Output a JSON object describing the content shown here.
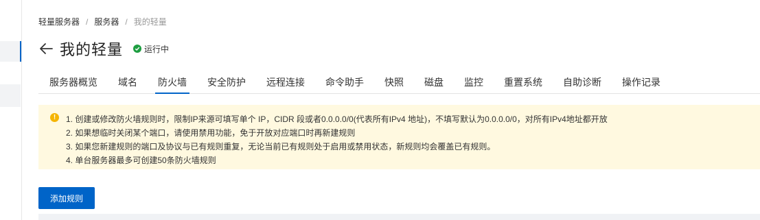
{
  "breadcrumb": {
    "items": [
      "轻量服务器",
      "服务器",
      "我的轻量"
    ],
    "separator": "/"
  },
  "header": {
    "title": "我的轻量",
    "status": "运行中",
    "status_color": "#1e9e41"
  },
  "tabs": [
    {
      "label": "服务器概览",
      "active": false
    },
    {
      "label": "域名",
      "active": false
    },
    {
      "label": "防火墙",
      "active": true
    },
    {
      "label": "安全防护",
      "active": false
    },
    {
      "label": "远程连接",
      "active": false
    },
    {
      "label": "命令助手",
      "active": false
    },
    {
      "label": "快照",
      "active": false
    },
    {
      "label": "磁盘",
      "active": false
    },
    {
      "label": "监控",
      "active": false
    },
    {
      "label": "重置系统",
      "active": false
    },
    {
      "label": "自助诊断",
      "active": false
    },
    {
      "label": "操作记录",
      "active": false
    }
  ],
  "notice": {
    "icon": "warning-icon",
    "lines": [
      "1. 创建或修改防火墙规则时，限制IP来源可填写单个 IP，CIDR 段或者0.0.0.0/0(代表所有IPv4 地址)，不填写默认为0.0.0.0/0，对所有IPv4地址都开放",
      "2. 如果想临时关闭某个端口，请使用禁用功能，免于开放对应端口时再新建规则",
      "3. 如果您新建规则的端口及协议与已有规则重复，无论当前已有规则处于启用或禁用状态，新规则均会覆盖已有规则。",
      "4. 单台服务器最多可创建50条防火墙规则"
    ]
  },
  "actions": {
    "add_rule_label": "添加规则"
  },
  "colors": {
    "accent": "#0064c8",
    "notice_bg": "#fff9e0",
    "warning": "#f5b400"
  }
}
